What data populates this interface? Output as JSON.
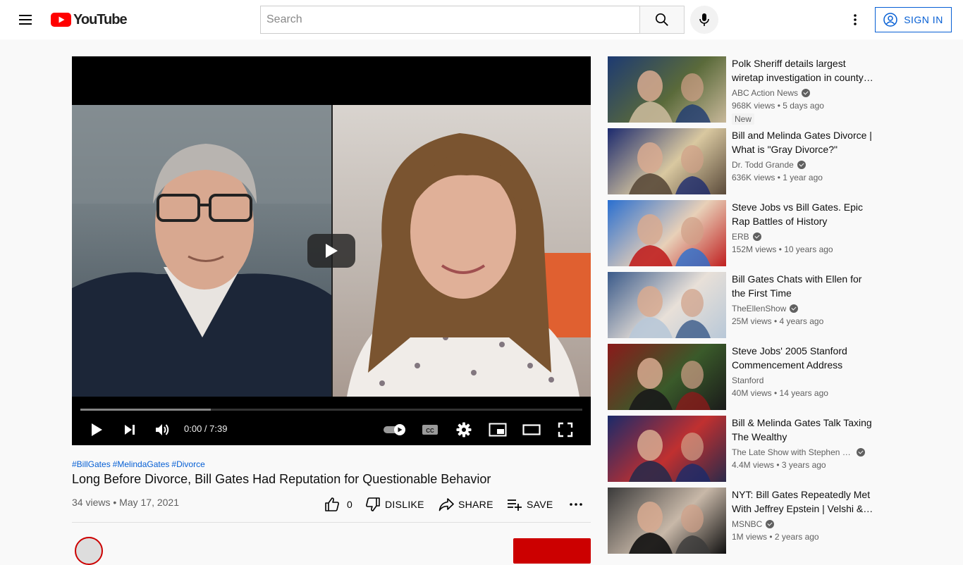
{
  "masthead": {
    "logo_text": "YouTube",
    "search_placeholder": "Search",
    "signin_label": "SIGN IN"
  },
  "player": {
    "time_display": "0:00 / 7:39",
    "progress_buffered": 0.26
  },
  "video": {
    "hashtags": [
      "#BillGates",
      "#MelindaGates",
      "#Divorce"
    ],
    "title": "Long Before Divorce, Bill Gates Had Reputation for Questionable Behavior",
    "views": "34 views",
    "date": "May 17, 2021",
    "meta_separator": "•",
    "like_count": "0",
    "dislike_label": "DISLIKE",
    "share_label": "SHARE",
    "save_label": "SAVE"
  },
  "recommendations": [
    {
      "title": "Polk Sheriff details largest wiretap investigation in county…",
      "channel": "ABC Action News",
      "verified": true,
      "stats": "968K views • 5 days ago",
      "badge": "New",
      "thumb_colors": [
        "#1d3a72",
        "#5a6a3a",
        "#c8b89a"
      ]
    },
    {
      "title": "Bill and Melinda Gates Divorce | What is \"Gray Divorce?\"",
      "channel": "Dr. Todd Grande",
      "verified": true,
      "stats": "636K views • 1 year ago",
      "thumb_colors": [
        "#1c2a6e",
        "#d9c8a0",
        "#5a4a3a"
      ]
    },
    {
      "title": "Steve Jobs vs Bill Gates. Epic Rap Battles of History",
      "channel": "ERB",
      "verified": true,
      "stats": "152M views • 10 years ago",
      "thumb_colors": [
        "#2a6fd0",
        "#e8d0b8",
        "#c02020"
      ]
    },
    {
      "title": "Bill Gates Chats with Ellen for the First Time",
      "channel": "TheEllenShow",
      "verified": true,
      "stats": "25M views • 4 years ago",
      "thumb_colors": [
        "#3a5a8a",
        "#e8e0d8",
        "#b8c8d8"
      ]
    },
    {
      "title": "Steve Jobs' 2005 Stanford Commencement Address",
      "channel": "Stanford",
      "verified": false,
      "stats": "40M views • 14 years ago",
      "thumb_colors": [
        "#8a1a1a",
        "#3a5a2a",
        "#1a1a1a"
      ]
    },
    {
      "title": "Bill & Melinda Gates Talk Taxing The Wealthy",
      "channel": "The Late Show with Stephen C…",
      "verified": true,
      "stats": "4.4M views • 3 years ago",
      "thumb_colors": [
        "#1a2a6a",
        "#c03030",
        "#2a2a4a"
      ]
    },
    {
      "title": "NYT: Bill Gates Repeatedly Met With Jeffrey Epstein | Velshi &…",
      "channel": "MSNBC",
      "verified": true,
      "stats": "1M views • 2 years ago",
      "thumb_colors": [
        "#3a3a3a",
        "#c8b8a8",
        "#101010"
      ]
    }
  ]
}
